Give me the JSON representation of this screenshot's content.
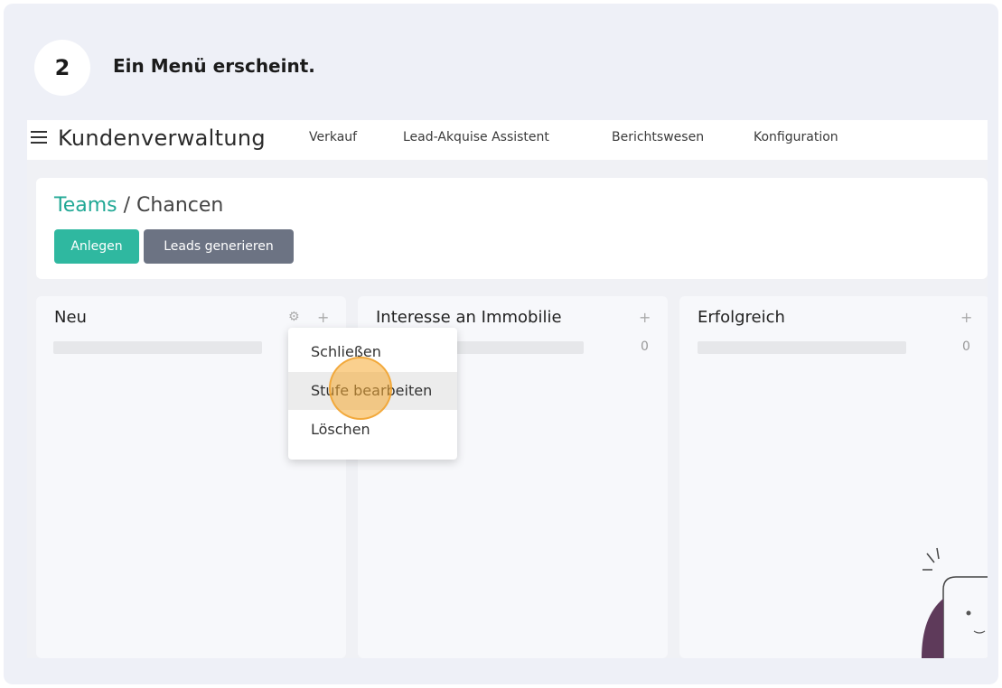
{
  "step": {
    "number": "2",
    "text": "Ein Menü erscheint."
  },
  "navbar": {
    "title": "Kundenverwaltung",
    "menu": [
      "Verkauf",
      "Lead-Akquise Assistent",
      "Berichtswesen",
      "Konfiguration"
    ]
  },
  "control_panel": {
    "breadcrumb_link": "Teams",
    "breadcrumb_sep": "/",
    "breadcrumb_current": "Chancen",
    "create_button": "Anlegen",
    "generate_button": "Leads generieren"
  },
  "columns": [
    {
      "title": "Neu",
      "count": ""
    },
    {
      "title": "Interesse an Immobilie",
      "count": "0"
    },
    {
      "title": "Erfolgreich",
      "count": "0"
    }
  ],
  "dropdown": {
    "items": [
      "Schließen",
      "Stufe bearbeiten",
      "Löschen"
    ],
    "highlighted": "Stufe bearbeiten"
  },
  "colors": {
    "accent": "#2fb8a0",
    "secondary": "#6c7383",
    "link": "#21a895",
    "highlight": "#f5aa32"
  }
}
